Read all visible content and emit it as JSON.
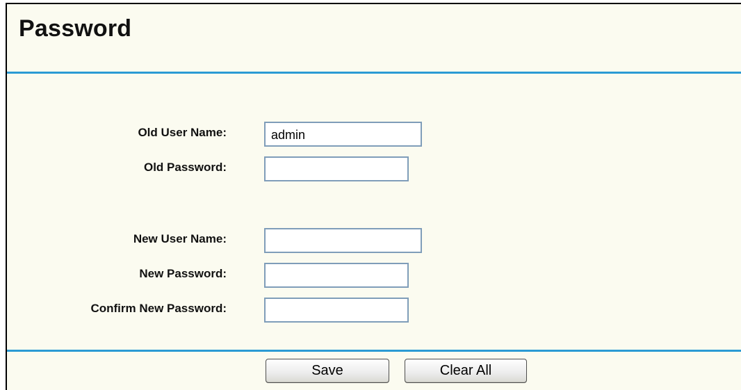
{
  "page": {
    "title": "Password"
  },
  "form": {
    "old_user_name": {
      "label": "Old User Name:",
      "value": "admin"
    },
    "old_password": {
      "label": "Old Password:",
      "value": ""
    },
    "new_user_name": {
      "label": "New User Name:",
      "value": ""
    },
    "new_password": {
      "label": "New Password:",
      "value": ""
    },
    "confirm_new_password": {
      "label": "Confirm New Password:",
      "value": ""
    }
  },
  "buttons": {
    "save_label": "Save",
    "clear_all_label": "Clear All"
  },
  "colors": {
    "background": "#fbfbf0",
    "divider": "#2b9bd4",
    "field_border": "#7f9db9"
  }
}
